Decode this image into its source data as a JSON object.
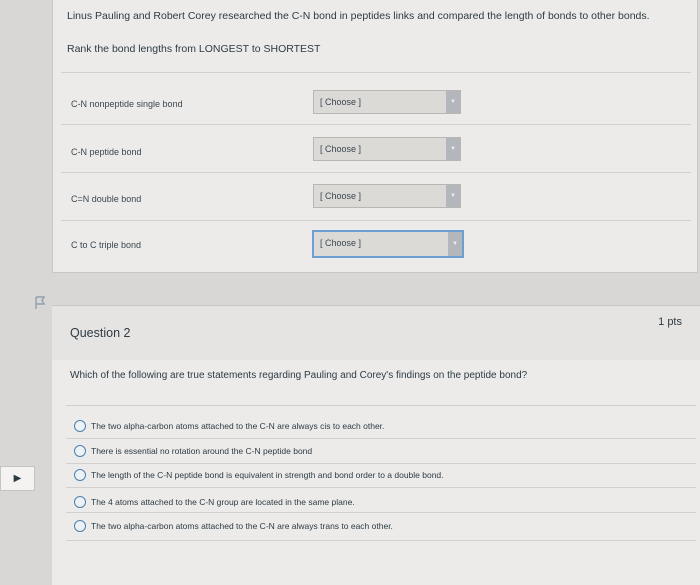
{
  "question1": {
    "intro": "Linus Pauling and Robert Corey researched the C-N bond in peptides links and compared the length of bonds to other bonds.",
    "instruction": "Rank the bond lengths from LONGEST to SHORTEST",
    "rows": [
      {
        "label": "C-N nonpeptide single bond",
        "select": "[ Choose ]"
      },
      {
        "label": "C-N peptide bond",
        "select": "[ Choose ]"
      },
      {
        "label": "C=N double bond",
        "select": "[ Choose ]"
      },
      {
        "label": "C to C triple bond",
        "select": "[ Choose ]"
      }
    ]
  },
  "question2": {
    "title": "Question 2",
    "points": "1 pts",
    "prompt": "Which of the following are true statements regarding Pauling and Corey's findings on the peptide bond?",
    "options": [
      "The two alpha-carbon atoms attached to the C-N are always cis to each other.",
      "There is essential no rotation around the C-N peptide bond",
      "The length of the C-N peptide bond is equivalent in strength and bond order to a double bond.",
      "The 4 atoms attached to the C-N group are located in the same plane.",
      "The two alpha-carbon atoms attached to the C-N are always trans to each other."
    ]
  },
  "icons": {
    "flag": "flag-icon",
    "arrow": "play-arrow-icon",
    "caret": "caret-down-icon"
  },
  "colors": {
    "accent": "#6d9fd0",
    "radio": "#4a7fb0",
    "text": "#2d3b45"
  }
}
